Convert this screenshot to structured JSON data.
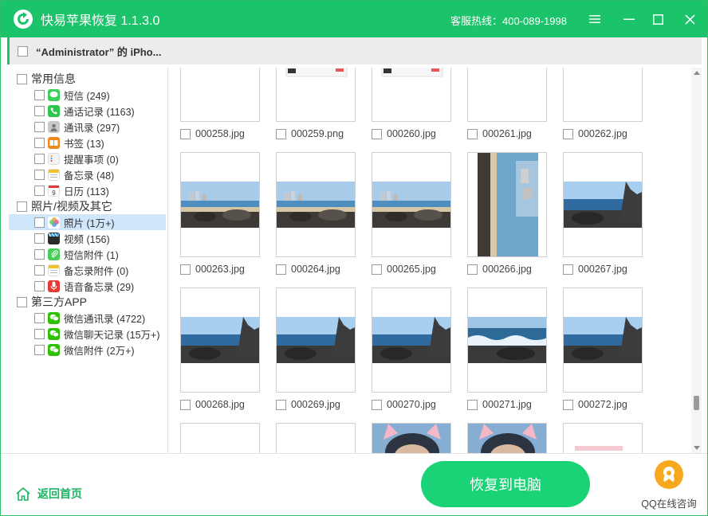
{
  "app": {
    "title": "快易苹果恢复 1.1.3.0",
    "hotline": "客服热线：400-089-1998",
    "brand_color": "#1bc46a"
  },
  "device": {
    "name": "“Administrator” 的 iPho..."
  },
  "sidebar": {
    "categories": [
      {
        "label": "常用信息",
        "items": [
          {
            "label": "短信 (249)",
            "icon": "message-icon",
            "color": "#3ccf5a"
          },
          {
            "label": "通话记录 (1163)",
            "icon": "phone-icon",
            "color": "#2ec64f"
          },
          {
            "label": "通讯录 (297)",
            "icon": "contacts-icon",
            "color": "#9a9a9a"
          },
          {
            "label": "书签 (13)",
            "icon": "bookmark-icon",
            "color": "#f08a1c"
          },
          {
            "label": "提醒事项 (0)",
            "icon": "reminder-icon",
            "color": "#e9e9e9"
          },
          {
            "label": "备忘录 (48)",
            "icon": "notes-icon",
            "color": "#f6c026"
          },
          {
            "label": "日历 (113)",
            "icon": "calendar-icon",
            "color": "#f2f2f2"
          }
        ]
      },
      {
        "label": "照片/视频及其它",
        "items": [
          {
            "label": "照片 (1万+)",
            "icon": "photos-icon",
            "color": "#f4a33a",
            "selected": true
          },
          {
            "label": "视频 (156)",
            "icon": "video-icon",
            "color": "#2b2b2b"
          },
          {
            "label": "短信附件 (1)",
            "icon": "attachment-icon",
            "color": "#4ccc5b"
          },
          {
            "label": "备忘录附件 (0)",
            "icon": "notes-attachment-icon",
            "color": "#f6c026"
          },
          {
            "label": "语音备忘录 (29)",
            "icon": "voice-memo-icon",
            "color": "#e53935"
          }
        ]
      },
      {
        "label": "第三方APP",
        "items": [
          {
            "label": "微信通讯录 (4722)",
            "icon": "wechat-icon",
            "color": "#2dc100"
          },
          {
            "label": "微信聊天记录 (15万+)",
            "icon": "wechat-icon",
            "color": "#2dc100"
          },
          {
            "label": "微信附件 (2万+)",
            "icon": "wechat-icon",
            "color": "#2dc100"
          }
        ]
      }
    ]
  },
  "photos": [
    {
      "name": "000258.jpg",
      "kind": "food"
    },
    {
      "name": "000259.png",
      "kind": "screenshot"
    },
    {
      "name": "000260.jpg",
      "kind": "screenshot"
    },
    {
      "name": "000261.jpg",
      "kind": "person-sea"
    },
    {
      "name": "000262.jpg",
      "kind": "person-sea"
    },
    {
      "name": "000263.jpg",
      "kind": "beach-city"
    },
    {
      "name": "000264.jpg",
      "kind": "beach-city"
    },
    {
      "name": "000265.jpg",
      "kind": "beach-city"
    },
    {
      "name": "000266.jpg",
      "kind": "beach-vertical"
    },
    {
      "name": "000267.jpg",
      "kind": "sea-rocks"
    },
    {
      "name": "000268.jpg",
      "kind": "sea-rocks"
    },
    {
      "name": "000269.jpg",
      "kind": "sea-rocks"
    },
    {
      "name": "000270.jpg",
      "kind": "sea-rocks"
    },
    {
      "name": "000271.jpg",
      "kind": "sea-waves"
    },
    {
      "name": "000272.jpg",
      "kind": "sea-rocks"
    },
    {
      "name": "",
      "kind": "blank"
    },
    {
      "name": "",
      "kind": "blank"
    },
    {
      "name": "",
      "kind": "selfie"
    },
    {
      "name": "",
      "kind": "selfie"
    },
    {
      "name": "",
      "kind": "blank-pink"
    }
  ],
  "footer": {
    "home_label": "返回首页",
    "recover_label": "恢复到电脑",
    "qq_label": "QQ在线咨询"
  }
}
